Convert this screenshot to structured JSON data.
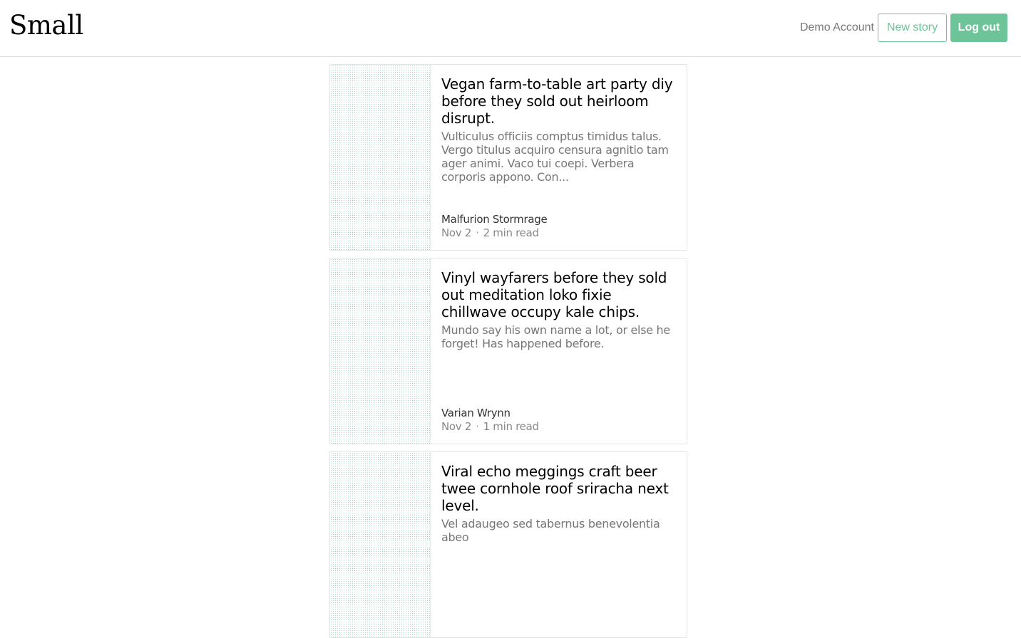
{
  "header": {
    "logo": "Small",
    "account_label": "Demo Account",
    "new_story_label": "New story",
    "logout_label": "Log out"
  },
  "colors": {
    "accent": "#6dc498",
    "muted_text": "#777777"
  },
  "stories": [
    {
      "title": "Vegan farm-to-table art party diy before they sold out heirloom disrupt.",
      "excerpt": "Vulticulus officiis comptus timidus talus. Vergo titulus acquiro censura agnitio tam ager animi. Vaco tui coepi. Verbera corporis appono. Con...",
      "author": "Malfurion Stormrage",
      "date": "Nov 2",
      "separator": "·",
      "read_time": "2 min read"
    },
    {
      "title": "Vinyl wayfarers before they sold out meditation loko fixie chillwave occupy kale chips.",
      "excerpt": "Mundo say his own name a lot, or else he forget! Has happened before.",
      "author": "Varian Wrynn",
      "date": "Nov 2",
      "separator": "·",
      "read_time": "1 min read"
    },
    {
      "title": "Viral echo meggings craft beer twee cornhole roof sriracha next level.",
      "excerpt": "Vel adaugeo sed tabernus benevolentia abeo",
      "author": "",
      "date": "",
      "separator": "",
      "read_time": ""
    }
  ]
}
